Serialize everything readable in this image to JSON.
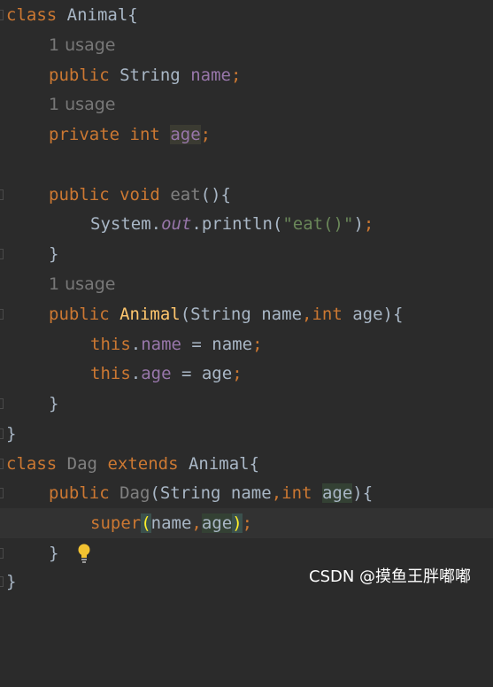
{
  "editor": {
    "lines": [
      {
        "segments": [
          [
            "kw",
            "class"
          ],
          [
            "",
            "Animal{"
          ]
        ]
      },
      {
        "hint": "1 usage"
      },
      {
        "segments": [
          [
            "kw",
            "public"
          ],
          [
            "",
            "String"
          ],
          [
            "fld",
            "name"
          ],
          [
            "kw",
            ";"
          ]
        ]
      },
      {
        "hint": "1 usage"
      },
      {
        "segments": [
          [
            "kw",
            "private"
          ],
          [
            "kw",
            "int"
          ],
          [
            "fld",
            "age"
          ],
          [
            "kw",
            ";"
          ]
        ]
      },
      {
        "segments": []
      },
      {
        "segments": [
          [
            "kw",
            "public"
          ],
          [
            "kw",
            "void"
          ],
          [
            "unused",
            "eat"
          ],
          [
            "",
            "(){"
          ]
        ]
      },
      {
        "segments": [
          [
            "",
            "System"
          ],
          [
            "stat",
            "out"
          ],
          [
            "",
            "println"
          ],
          [
            "str",
            "\"eat()\""
          ],
          [
            "kw",
            ";"
          ]
        ]
      },
      {
        "segments": [
          [
            "",
            "}"
          ]
        ]
      },
      {
        "hint": "1 usage"
      },
      {
        "segments": [
          [
            "kw",
            "public"
          ],
          [
            "fn",
            "Animal"
          ],
          [
            "",
            "String name"
          ],
          [
            "kw",
            ","
          ],
          [
            "kw",
            "int"
          ],
          [
            "",
            "age"
          ]
        ]
      },
      {
        "segments": [
          [
            "kw",
            "this"
          ],
          [
            "fld",
            "name"
          ],
          [
            "",
            "name"
          ],
          [
            "kw",
            ";"
          ]
        ]
      },
      {
        "segments": [
          [
            "kw",
            "this"
          ],
          [
            "fld",
            "age"
          ],
          [
            "",
            "age"
          ],
          [
            "kw",
            ";"
          ]
        ]
      },
      {
        "segments": [
          [
            "",
            "}"
          ]
        ]
      },
      {
        "segments": [
          [
            "",
            "}"
          ]
        ]
      },
      {
        "segments": [
          [
            "kw",
            "class"
          ],
          [
            "unused",
            "Dag"
          ],
          [
            "kw",
            "extends"
          ],
          [
            "",
            "Animal{"
          ]
        ]
      },
      {
        "segments": [
          [
            "kw",
            "public"
          ],
          [
            "unused",
            "Dag"
          ],
          [
            "",
            "String name"
          ],
          [
            "kw",
            ","
          ],
          [
            "kw",
            "int"
          ],
          [
            "",
            "age"
          ]
        ]
      },
      {
        "segments": [
          [
            "kw",
            "super"
          ],
          [
            "",
            "name"
          ],
          [
            "kw",
            ","
          ],
          [
            "",
            "age"
          ],
          [
            "kw",
            ";"
          ]
        ]
      },
      {
        "segments": [
          [
            "",
            "}"
          ]
        ]
      },
      {
        "segments": [
          [
            "",
            "}"
          ]
        ]
      }
    ]
  },
  "text": {
    "l1_class": "class",
    "l1_rest": "Animal{",
    "h1": "1 usage",
    "l3_public": "public",
    "l3_type": "String",
    "l3_name": "name",
    "l3_semi": ";",
    "h2": "1 usage",
    "l5_private": "private",
    "l5_int": "int",
    "l5_age": "age",
    "l5_semi": ";",
    "l7_public": "public",
    "l7_void": "void",
    "l7_eat": "eat",
    "l7_rest": "(){",
    "l8_system": "System.",
    "l8_out": "out",
    "l8_println": ".println(",
    "l8_str": "\"eat()\"",
    "l8_close": ")",
    "l8_semi": ";",
    "l9_brace": "}",
    "h3": "1 usage",
    "l11_public": "public",
    "l11_ctor": "Animal",
    "l11_params": "(String name",
    "l11_comma": ",",
    "l11_int": "int",
    "l11_end": " age){",
    "l12_this": "this",
    "l12_dot": ".",
    "l12_name": "name",
    "l12_rest": " = name",
    "l12_semi": ";",
    "l13_this": "this",
    "l13_dot": ".",
    "l13_age": "age",
    "l13_rest": " = age",
    "l13_semi": ";",
    "l14_brace": "}",
    "l15_brace": "}",
    "l16_class": "class",
    "l16_dag": "Dag",
    "l16_extends": "extends",
    "l16_rest": "Animal{",
    "l17_public": "public",
    "l17_dag": "Dag",
    "l17_params": "(String name",
    "l17_comma": ",",
    "l17_int": "int",
    "l17_age": "age",
    "l17_end": "){",
    "l18_super": "super",
    "l18_open": "(",
    "l18_name": "name",
    "l18_comma": ",",
    "l18_age": "age",
    "l18_close": ")",
    "l18_semi": ";",
    "l19_brace": "}",
    "l20_brace": "}"
  },
  "watermark": "CSDN @摸鱼王胖嘟嘟",
  "icons": {
    "bulb": "lightbulb-icon"
  },
  "colors": {
    "background": "#2b2b2b",
    "keyword": "#cc7832",
    "field": "#9876aa",
    "string": "#6a8759",
    "method": "#ffc66d",
    "text": "#a9b7c6"
  }
}
